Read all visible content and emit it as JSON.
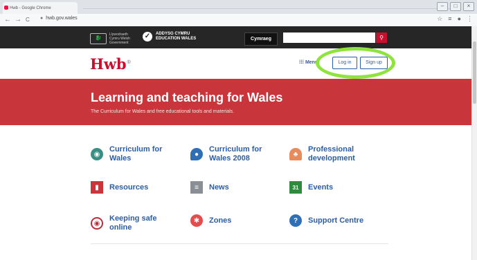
{
  "browser": {
    "tab_title": "Hwb - Google Chrome",
    "url": "hwb.gov.wales",
    "nav": [
      "←",
      "→",
      "C"
    ],
    "right_icons": [
      "☆",
      "≡",
      "●",
      "⋮"
    ]
  },
  "site_bar": {
    "gov_text": "Llywodraeth Cymru Welsh Government",
    "edu_text_line1": "ADDYSG CYMRU",
    "edu_text_line2": "EDUCATION WALES",
    "cymraeg_label": "Cymraeg",
    "search_placeholder": ""
  },
  "header": {
    "logo": "Hwb",
    "logo_mark": "®",
    "menu_label": "Menu",
    "login_label": "Log in",
    "signup_label": "Sign up"
  },
  "hero": {
    "title": "Learning and teaching for Wales",
    "subtitle": "The Curriculum for Wales and free educational tools and materials."
  },
  "tiles": [
    {
      "label": "Curriculum for Wales",
      "icon": "curriculum-icon",
      "color": "#3a8f85"
    },
    {
      "label": "Curriculum for Wales 2008",
      "icon": "location-pin-icon",
      "color": "#2f6fb6"
    },
    {
      "label": "Professional development",
      "icon": "tree-icon",
      "color": "#e88b5c"
    },
    {
      "label": "Resources",
      "icon": "books-icon",
      "color": "#c8353b"
    },
    {
      "label": "News",
      "icon": "newspaper-icon",
      "color": "#8a8f96"
    },
    {
      "label": "Events",
      "icon": "calendar-icon",
      "color": "#2e8b3d"
    },
    {
      "label": "Keeping safe online",
      "icon": "shield-eye-icon",
      "color": "#b62f3a"
    },
    {
      "label": "Zones",
      "icon": "pinwheel-icon",
      "color": "#e54c4c"
    },
    {
      "label": "Support Centre",
      "icon": "question-icon",
      "color": "#2f6fb6"
    }
  ],
  "events_icon_text": "31",
  "colors": {
    "brand_red": "#c8102e",
    "hero_red": "#c8353b",
    "link_blue": "#2a5da8",
    "highlight": "#8ee43c"
  }
}
